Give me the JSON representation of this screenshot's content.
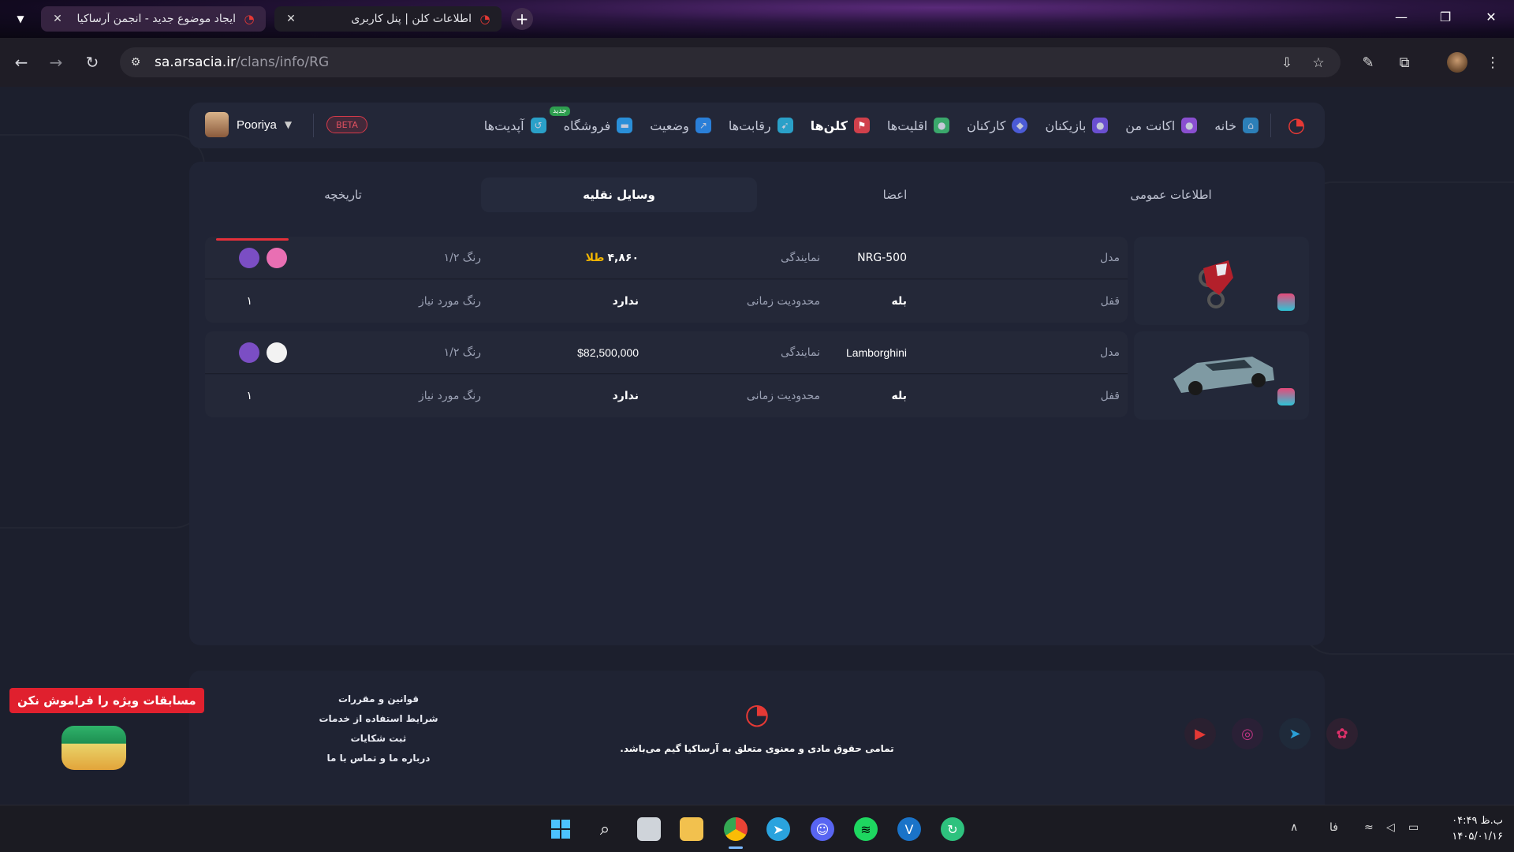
{
  "browser": {
    "tabs": [
      {
        "title": "ایجاد موضوع جدید - انجمن آرساکیا",
        "active": false
      },
      {
        "title": "اطلاعات کلن | پنل کاربری",
        "active": true
      }
    ],
    "new_tab_label": "+",
    "url_host": "sa.arsacia.ir",
    "url_path": "/clans/info/RG"
  },
  "header": {
    "nav": [
      {
        "label": "خانه",
        "icon": "home-icon",
        "color": "#2c7fb8"
      },
      {
        "label": "اکانت من",
        "icon": "user-icon",
        "color": "#8a4fd0"
      },
      {
        "label": "بازیکنان",
        "icon": "players-icon",
        "color": "#6a4fd0"
      },
      {
        "label": "کارکنان",
        "icon": "staff-shield-icon",
        "color": "#4b5bd6"
      },
      {
        "label": "اقلیت‌ها",
        "icon": "minorities-icon",
        "color": "#3aa86b"
      },
      {
        "label": "کلن‌ها",
        "icon": "clans-flags-icon",
        "color": "#d0404b",
        "active": true
      },
      {
        "label": "رقابت‌ها",
        "icon": "races-icon",
        "color": "#2aa0c8"
      },
      {
        "label": "وضعیت",
        "icon": "status-chart-icon",
        "color": "#2a7fd8"
      },
      {
        "label": "فروشگاه",
        "icon": "cart-icon",
        "color": "#2a8fd8"
      },
      {
        "label": "آپدیت‌ها",
        "icon": "updates-icon",
        "color": "#2aa0c8",
        "badge": "جدید"
      }
    ],
    "beta_label": "BETA",
    "user_name": "Pooriya"
  },
  "panel": {
    "tabs": [
      {
        "label": "اطلاعات عمومی",
        "active": false
      },
      {
        "label": "اعضا",
        "active": false
      },
      {
        "label": "وسایل نقلیه",
        "active": true
      },
      {
        "label": "تاریخچه",
        "active": false
      }
    ],
    "labels": {
      "model": "مدل",
      "dealership": "نمایندگی",
      "color": "رنگ ۱/۲",
      "lock": "قفل",
      "time_limit": "محدودیت زمانی",
      "required_color": "رنگ مورد نیاز"
    },
    "vehicles": [
      {
        "model": "NRG-500",
        "price": "۴,۸۶۰",
        "price_unit": "طلا",
        "color1": "#e96fb3",
        "color2": "#7b4ec4",
        "lock": "بله",
        "time_limit": "ندارد",
        "required_color": "۱"
      },
      {
        "model": "Lamborghini",
        "price": "$82,500,000",
        "price_unit": "",
        "color1": "#f2f2f2",
        "color2": "#7b4ec4",
        "lock": "بله",
        "time_limit": "ندارد",
        "required_color": "۱"
      }
    ]
  },
  "footer": {
    "copyright": "تمامی حقوق مادی و معنوی متعلق به آرساکیا گیم می‌باشد.",
    "links": [
      "قوانین و مقررات",
      "شرایط استفاده از خدمات",
      "ثبت شکایات",
      "درباره ما و تماس با ما"
    ],
    "social": [
      {
        "name": "youtube-icon",
        "color": "#e53935"
      },
      {
        "name": "instagram-icon",
        "color": "#c13584"
      },
      {
        "name": "telegram-icon",
        "color": "#2a9fd6"
      },
      {
        "name": "aparat-icon",
        "color": "#e0306a"
      }
    ],
    "promo": "مسابقات ویژه را فراموش نکن"
  },
  "taskbar": {
    "lang": "فا",
    "time": "۰۴:۴۹ ب.ظ",
    "date": "۱۴۰۵/۰۱/۱۶"
  }
}
